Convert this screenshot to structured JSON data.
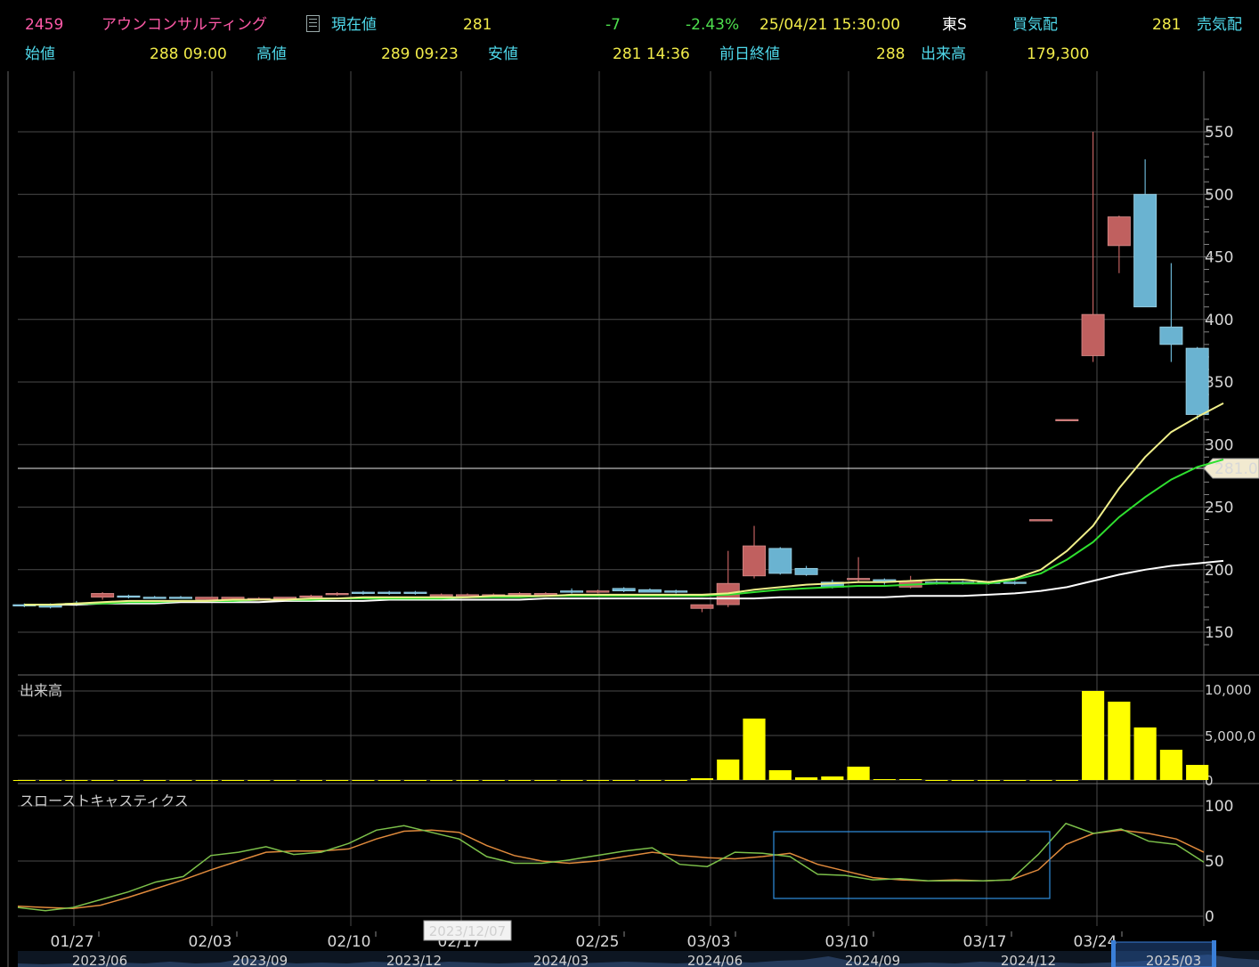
{
  "header": {
    "code": "2459",
    "name": "アウンコンサルティング",
    "current_label": "現在値",
    "current_value": "281",
    "change": "-7",
    "change_pct": "-2.43%",
    "datetime": "25/04/21  15:30:00",
    "market": "東S",
    "bid_label": "買気配",
    "bid_value": "281",
    "ask_label": "売気配",
    "open_label": "始値",
    "open_value": "288  09:00",
    "high_label": "高値",
    "high_value": "289  09:23",
    "low_label": "安値",
    "low_value": "281  14:36",
    "prev_close_label": "前日終値",
    "prev_close_value": "288",
    "volume_label": "出来高",
    "volume_value": "179,300"
  },
  "colors": {
    "up": "#c0605f",
    "down": "#6ab3d1",
    "ma_short": "#f0ef8a",
    "ma_mid": "#2fe02f",
    "ma_long": "#ffffff",
    "volume": "#ffff00",
    "stoch_k": "#7cc04a",
    "stoch_d": "#e08a3c",
    "grid": "#4a4a4a",
    "highlight_box": "#2f8fe0"
  },
  "chart_data": [
    {
      "type": "candlestick",
      "x_labels": [
        "01/27",
        "02/03",
        "02/10",
        "02/17",
        "02/25",
        "03/03",
        "03/10",
        "03/17",
        "03/24"
      ],
      "range_labels": [
        "2023/06",
        "2023/09",
        "2023/12",
        "2024/03",
        "2024/06",
        "2024/09",
        "2024/12",
        "2025/03"
      ],
      "cursor_date": "2023/12/07",
      "ylim": [
        130,
        560
      ],
      "yticks": [
        150,
        200,
        250,
        300,
        350,
        400,
        450,
        500,
        550
      ],
      "last_price_label": "281.0",
      "last_price": 281,
      "candles": [
        {
          "o": 172,
          "h": 173,
          "l": 170,
          "c": 171
        },
        {
          "o": 172,
          "h": 173,
          "l": 169,
          "c": 170
        },
        {
          "o": 173,
          "h": 175,
          "l": 171,
          "c": 172
        },
        {
          "o": 178,
          "h": 182,
          "l": 176,
          "c": 181
        },
        {
          "o": 179,
          "h": 180,
          "l": 177,
          "c": 178
        },
        {
          "o": 178,
          "h": 179,
          "l": 177,
          "c": 177
        },
        {
          "o": 178,
          "h": 179,
          "l": 177,
          "c": 177
        },
        {
          "o": 176,
          "h": 178,
          "l": 175,
          "c": 178
        },
        {
          "o": 176,
          "h": 178,
          "l": 175,
          "c": 178
        },
        {
          "o": 177,
          "h": 178,
          "l": 176,
          "c": 177
        },
        {
          "o": 177,
          "h": 178,
          "l": 176,
          "c": 178
        },
        {
          "o": 178,
          "h": 180,
          "l": 177,
          "c": 179
        },
        {
          "o": 180,
          "h": 182,
          "l": 179,
          "c": 181
        },
        {
          "o": 182,
          "h": 183,
          "l": 180,
          "c": 181
        },
        {
          "o": 182,
          "h": 183,
          "l": 180,
          "c": 181
        },
        {
          "o": 182,
          "h": 183,
          "l": 180,
          "c": 181
        },
        {
          "o": 180,
          "h": 181,
          "l": 179,
          "c": 180
        },
        {
          "o": 180,
          "h": 181,
          "l": 179,
          "c": 180
        },
        {
          "o": 179,
          "h": 181,
          "l": 178,
          "c": 180
        },
        {
          "o": 180,
          "h": 182,
          "l": 179,
          "c": 181
        },
        {
          "o": 181,
          "h": 182,
          "l": 180,
          "c": 181
        },
        {
          "o": 183,
          "h": 185,
          "l": 181,
          "c": 182
        },
        {
          "o": 182,
          "h": 184,
          "l": 181,
          "c": 183
        },
        {
          "o": 185,
          "h": 186,
          "l": 182,
          "c": 183
        },
        {
          "o": 184,
          "h": 185,
          "l": 182,
          "c": 182
        },
        {
          "o": 183,
          "h": 184,
          "l": 181,
          "c": 182
        },
        {
          "o": 169,
          "h": 172,
          "l": 166,
          "c": 172
        },
        {
          "o": 172,
          "h": 215,
          "l": 170,
          "c": 189
        },
        {
          "o": 195,
          "h": 235,
          "l": 193,
          "c": 219
        },
        {
          "o": 217,
          "h": 218,
          "l": 196,
          "c": 197
        },
        {
          "o": 201,
          "h": 203,
          "l": 195,
          "c": 196
        },
        {
          "o": 190,
          "h": 192,
          "l": 185,
          "c": 186
        },
        {
          "o": 192,
          "h": 210,
          "l": 190,
          "c": 193
        },
        {
          "o": 192,
          "h": 193,
          "l": 188,
          "c": 190
        },
        {
          "o": 186,
          "h": 195,
          "l": 185,
          "c": 191
        },
        {
          "o": 190,
          "h": 192,
          "l": 188,
          "c": 189
        },
        {
          "o": 190,
          "h": 191,
          "l": 188,
          "c": 189
        },
        {
          "o": 190,
          "h": 191,
          "l": 188,
          "c": 189
        },
        {
          "o": 190,
          "h": 191,
          "l": 188,
          "c": 189
        },
        {
          "o": 240,
          "h": 240,
          "l": 240,
          "c": 240
        },
        {
          "o": 320,
          "h": 320,
          "l": 320,
          "c": 320
        },
        {
          "o": 371,
          "h": 550,
          "l": 366,
          "c": 404
        },
        {
          "o": 459,
          "h": 483,
          "l": 437,
          "c": 482
        },
        {
          "o": 500,
          "h": 528,
          "l": 410,
          "c": 410
        },
        {
          "o": 394,
          "h": 445,
          "l": 366,
          "c": 380
        },
        {
          "o": 377,
          "h": 378,
          "l": 320,
          "c": 324
        }
      ],
      "ma_short": [
        172,
        172,
        173,
        174,
        175,
        175,
        175,
        175,
        176,
        176,
        176,
        177,
        177,
        178,
        178,
        178,
        178,
        178,
        179,
        179,
        179,
        180,
        180,
        180,
        180,
        180,
        180,
        181,
        184,
        186,
        188,
        189,
        190,
        190,
        191,
        192,
        192,
        190,
        193,
        200,
        215,
        235,
        265,
        290,
        310,
        322,
        333
      ],
      "ma_mid": [
        172,
        172,
        173,
        173,
        174,
        174,
        175,
        175,
        175,
        176,
        176,
        176,
        177,
        177,
        177,
        177,
        177,
        178,
        178,
        178,
        179,
        179,
        179,
        179,
        179,
        179,
        179,
        180,
        182,
        184,
        185,
        186,
        187,
        187,
        188,
        189,
        189,
        189,
        192,
        197,
        208,
        222,
        242,
        258,
        272,
        282,
        288
      ],
      "ma_long": [
        172,
        172,
        172,
        173,
        173,
        173,
        174,
        174,
        174,
        174,
        175,
        175,
        175,
        175,
        176,
        176,
        176,
        176,
        176,
        176,
        177,
        177,
        177,
        177,
        177,
        177,
        177,
        177,
        177,
        178,
        178,
        178,
        178,
        178,
        179,
        179,
        179,
        180,
        181,
        183,
        186,
        191,
        196,
        200,
        203,
        205,
        207
      ]
    },
    {
      "type": "bar",
      "title": "出来高",
      "yticks": [
        "0",
        "5,000,0",
        "10,000"
      ],
      "ylim": [
        0,
        10000000
      ],
      "values": [
        0,
        0,
        0,
        0,
        0,
        0,
        0,
        0,
        0,
        0,
        0,
        0,
        0,
        0,
        0,
        0,
        0,
        0,
        0,
        0,
        0,
        0,
        0,
        0,
        0,
        0,
        200000,
        2300000,
        6900000,
        1100000,
        300000,
        400000,
        1500000,
        100000,
        100000,
        0,
        0,
        0,
        0,
        0,
        0,
        10000000,
        8800000,
        5900000,
        3400000,
        1700000
      ]
    },
    {
      "type": "line",
      "title": "スローストキャスティクス",
      "yticks": [
        "0",
        "50",
        "100"
      ],
      "ylim": [
        0,
        100
      ],
      "k": [
        8,
        5,
        8,
        15,
        22,
        31,
        36,
        55,
        58,
        63,
        56,
        58,
        66,
        78,
        82,
        76,
        70,
        54,
        48,
        48,
        51,
        55,
        59,
        62,
        47,
        45,
        58,
        57,
        54,
        38,
        37,
        33,
        34,
        32,
        32,
        32,
        33,
        56,
        84,
        75,
        79,
        68,
        65,
        49
      ],
      "d": [
        9,
        8,
        7,
        10,
        17,
        25,
        33,
        42,
        50,
        58,
        59,
        59,
        61,
        70,
        77,
        78,
        76,
        64,
        55,
        50,
        48,
        50,
        54,
        58,
        55,
        53,
        52,
        54,
        57,
        47,
        41,
        35,
        33,
        32,
        33,
        32,
        33,
        42,
        65,
        75,
        78,
        75,
        70,
        58
      ]
    }
  ]
}
